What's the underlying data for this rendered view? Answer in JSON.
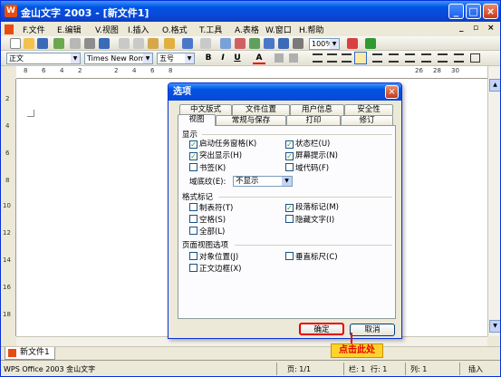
{
  "window": {
    "title": "金山文字 2003 - [新文件1]",
    "app_icon": "W",
    "min": "_",
    "max": "□",
    "close": "×",
    "menu_min": "_",
    "menu_restore": "▫",
    "menu_close": "×"
  },
  "menu": [
    "F.文件",
    "E.编辑",
    "V.视图",
    "I.插入",
    "O.格式",
    "T.工具",
    "A.表格",
    "W.窗口",
    "H.帮助"
  ],
  "toolbar": {
    "zoom": "100%"
  },
  "format": {
    "style": "正文",
    "font": "Times New Roman",
    "size": "五号",
    "bold": "B",
    "italic": "I",
    "underline": "U",
    "fontcolor": "A"
  },
  "ruler": [
    "8",
    "6",
    "4",
    "2",
    "",
    "2",
    "4",
    "6",
    "8",
    "10",
    "12",
    "14",
    "16",
    "18",
    "20",
    "22",
    "24",
    "26",
    "28",
    "30"
  ],
  "vruler": [
    "2",
    "4",
    "6",
    "8",
    "10",
    "12",
    "14",
    "16",
    "18",
    "20"
  ],
  "dialog": {
    "title": "选项",
    "tabs_row1": [
      "中文版式",
      "文件位置",
      "用户信息",
      "安全性"
    ],
    "tabs_row2": [
      "视图",
      "常规与保存",
      "打印",
      "修订"
    ],
    "section_display": "显示",
    "display_items": [
      {
        "label": "启动任务窗格(K)",
        "checked": true
      },
      {
        "label": "状态栏(U)",
        "checked": true
      },
      {
        "label": "突出显示(H)",
        "checked": true
      },
      {
        "label": "屏幕提示(N)",
        "checked": true
      },
      {
        "label": "书签(K)",
        "checked": false
      },
      {
        "label": "域代码(F)",
        "checked": false
      }
    ],
    "shading_label": "域底纹(E):",
    "shading_value": "不显示",
    "section_marks": "格式标记",
    "marks_items": [
      {
        "label": "制表符(T)",
        "checked": false
      },
      {
        "label": "段落标记(M)",
        "checked": true
      },
      {
        "label": "空格(S)",
        "checked": false
      },
      {
        "label": "隐藏文字(I)",
        "checked": false
      },
      {
        "label": "全部(L)",
        "checked": false
      }
    ],
    "section_page": "页面视图选项",
    "page_items": [
      {
        "label": "对象位置(J)",
        "checked": false
      },
      {
        "label": "垂直标尺(C)",
        "checked": false
      },
      {
        "label": "正文边框(X)",
        "checked": false
      }
    ],
    "ok": "确定",
    "cancel": "取消"
  },
  "doc_tab": "新文件1",
  "status": {
    "app": "WPS Office 2003 金山文字",
    "page": "页: 1/1",
    "col": "栏: 1",
    "row": "行: 1",
    "column": "列: 1",
    "ins": "插入"
  },
  "annotation": "点击此处"
}
